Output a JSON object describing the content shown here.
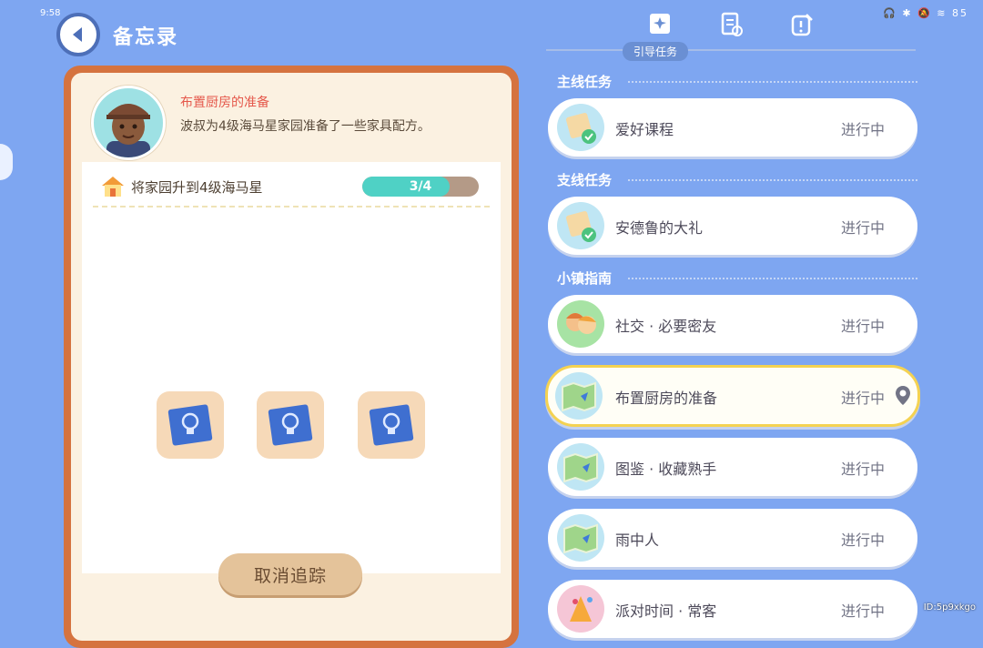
{
  "status_bar": {
    "time": "9:58",
    "icons": "🎧 ✱ 🔕 ≋ 85"
  },
  "header": {
    "title": "备忘录"
  },
  "detail": {
    "quest_title": "布置厨房的准备",
    "quest_desc": "波叔为4级海马星家园准备了一些家具配方。",
    "task": {
      "label": "将家园升到4级海马星",
      "progress_text": "3/4",
      "progress_fraction": 0.75
    },
    "rewards": [
      "blueprint-icon",
      "blueprint-icon",
      "blueprint-icon"
    ],
    "cancel_label": "取消追踪"
  },
  "tabs": {
    "active_label": "引导任务"
  },
  "sections": {
    "main": "主线任务",
    "side": "支线任务",
    "guide": "小镇指南"
  },
  "quests": [
    {
      "name": "爱好课程",
      "status": "进行中"
    },
    {
      "name": "安德鲁的大礼",
      "status": "进行中"
    },
    {
      "name": "社交 · 必要密友",
      "status": "进行中"
    },
    {
      "name": "布置厨房的准备",
      "status": "进行中"
    },
    {
      "name": "图鉴 · 收藏熟手",
      "status": "进行中"
    },
    {
      "name": "雨中人",
      "status": "进行中"
    },
    {
      "name": "派对时间 · 常客",
      "status": "进行中"
    }
  ],
  "watermark": "ID:5p9xkgo",
  "colors": {
    "background": "#7ea6f1",
    "panel_border": "#d5733f",
    "progress": "#4fd1c5",
    "active_border": "#f4d252"
  }
}
